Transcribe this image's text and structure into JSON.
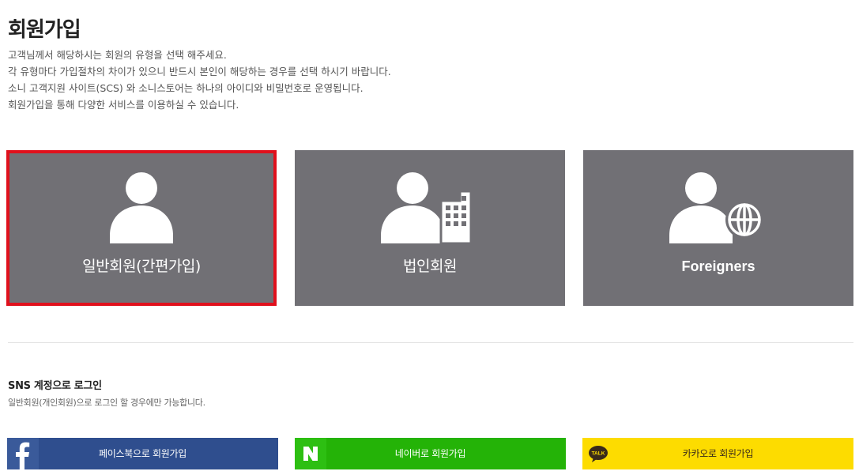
{
  "page": {
    "title": "회원가입",
    "intro_lines": [
      "고객님께서 해당하시는 회원의 유형을 선택 해주세요.",
      "각 유형마다 가입절차의 차이가 있으니 반드시 본인이 해당하는 경우를 선택 하시기 바랍니다.",
      "소니 고객지원 사이트(SCS) 와 소니스토어는 하나의 아이디와 비밀번호로 운영됩니다.",
      "회원가입을 통해 다양한 서비스를 이용하실 수 있습니다."
    ]
  },
  "member_types": [
    {
      "label": "일반회원(간편가입)",
      "icon": "person-icon",
      "selected": true
    },
    {
      "label": "법인회원",
      "icon": "person-building-icon",
      "selected": false
    },
    {
      "label": "Foreigners",
      "icon": "person-globe-icon",
      "selected": false
    }
  ],
  "sns": {
    "title": "SNS 계정으로 로그인",
    "note": "일반회원(개인회원)으로 로그인 할 경우에만 가능합니다.",
    "buttons": [
      {
        "label": "페이스북으로 회원가입",
        "icon": "facebook-icon",
        "color": "#2f4e8e"
      },
      {
        "label": "네이버로 회원가입",
        "icon": "naver-icon",
        "color": "#24b307"
      },
      {
        "label": "카카오로 회원가입",
        "icon": "kakao-talk-icon",
        "logo_text": "TALK",
        "color": "#fddc00"
      }
    ]
  },
  "colors": {
    "card_background": "#717075",
    "selected_border": "#e0101c"
  }
}
